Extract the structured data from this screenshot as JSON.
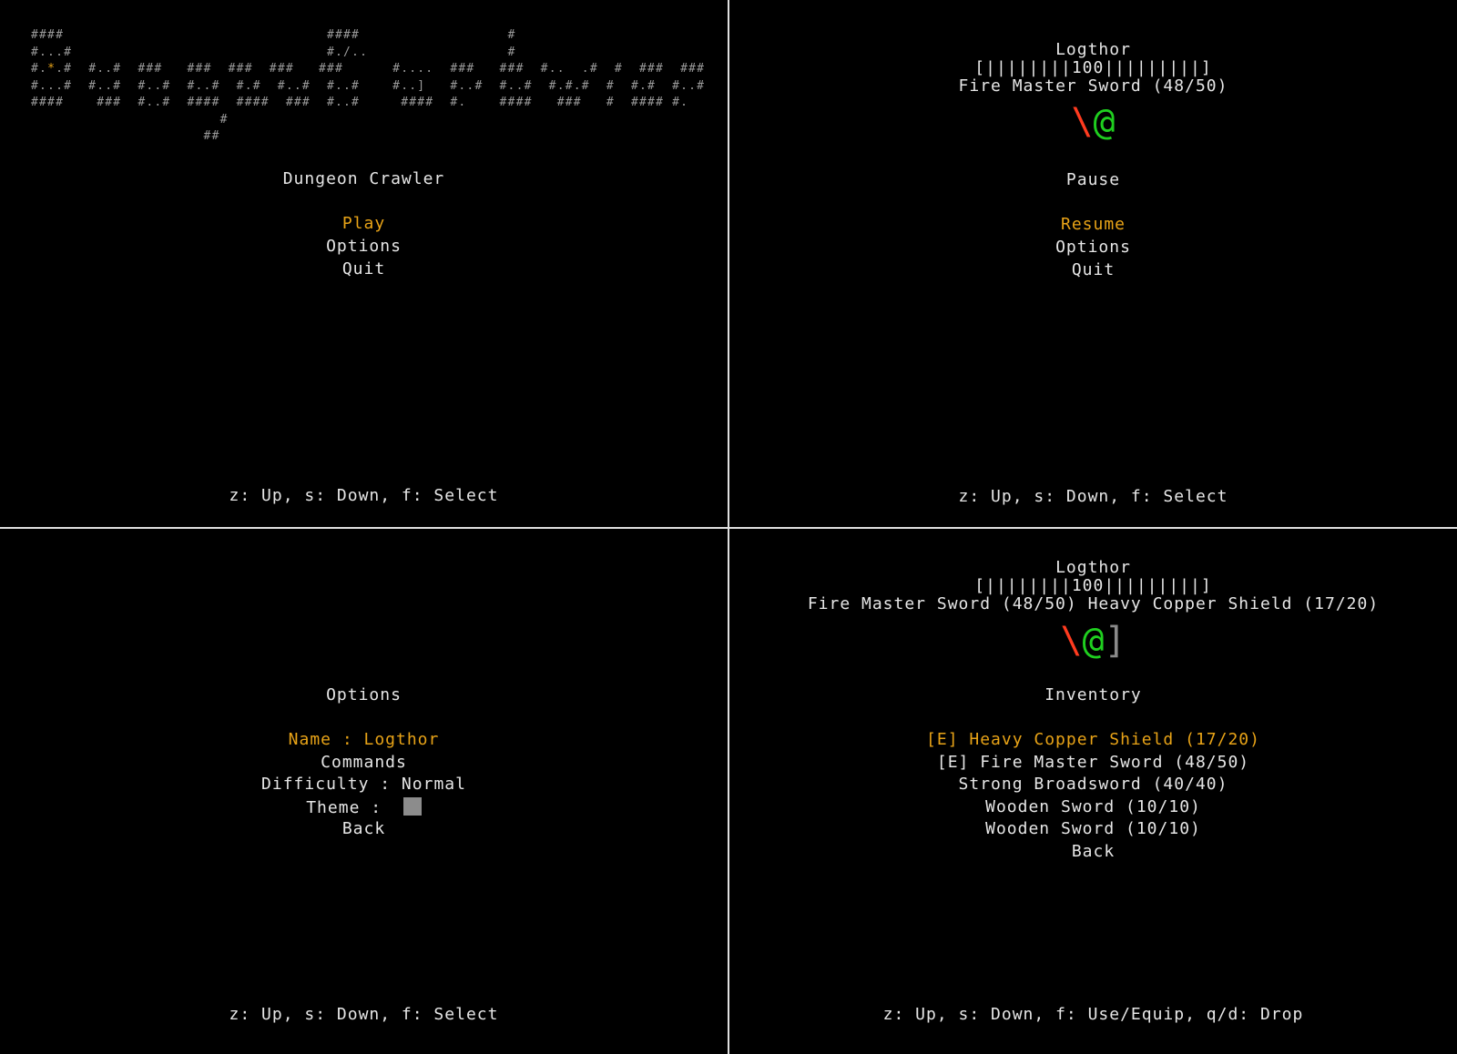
{
  "menu": {
    "logo_lines": [
      "####                                ####                  #",
      "#...#                               #./..                 #",
      "#.*.#  #..#  ###   ###  ###  ###   ###      #....  ###   ###  #..  .#  #  ###  ###",
      "#...#  #..#  #..#  #..#  #.#  #..#  #..#    #..]   #..#  #..#  #.#.#  #  #.#  #..#",
      "####    ###  #..#  ####  ####  ###  #..#     ####  #.    ####   ###   #  #### #.",
      "                       #",
      "                     ##"
    ],
    "title": "Dungeon Crawler",
    "items": [
      "Play",
      "Options",
      "Quit"
    ],
    "selected_index": 0,
    "hint": "z: Up, s: Down, f: Select"
  },
  "pause": {
    "player_name": "Logthor",
    "health_bar": "[||||||||100|||||||||]",
    "health": 100,
    "equipment": "Fire Master Sword (48/50)",
    "sprite": {
      "weapon": "\\",
      "player": "@"
    },
    "title": "Pause",
    "items": [
      "Resume",
      "Options",
      "Quit"
    ],
    "selected_index": 0,
    "hint": "z: Up, s: Down, f: Select"
  },
  "options": {
    "title": "Options",
    "items": {
      "name": "Name : Logthor",
      "commands": "Commands",
      "difficulty": "Difficulty : Normal",
      "theme": "Theme :",
      "back": "Back"
    },
    "theme_color": "#8c8c8c",
    "selected": "name",
    "hint": "z: Up, s: Down, f: Select"
  },
  "inventory": {
    "player_name": "Logthor",
    "health_bar": "[||||||||100|||||||||]",
    "health": 100,
    "equipment": "Fire Master Sword (48/50) Heavy Copper Shield (17/20)",
    "sprite": {
      "weapon": "\\",
      "player": "@",
      "shield": "]"
    },
    "title": "Inventory",
    "items": [
      "[E] Heavy Copper Shield (17/20)",
      "[E] Fire Master Sword (48/50)",
      "Strong Broadsword (40/40)",
      "Wooden Sword (10/10)",
      "Wooden Sword (10/10)",
      "Back"
    ],
    "selected_index": 0,
    "hint": "z: Up, s: Down, f: Use/Equip, q/d: Drop"
  },
  "colors": {
    "background": "#000000",
    "text": "#e6e6e6",
    "selected": "#e8a317",
    "weapon": "#ff3b1f",
    "player": "#1fcf1f",
    "shield": "#8a8a8a",
    "logo": "#9a9a9a"
  }
}
